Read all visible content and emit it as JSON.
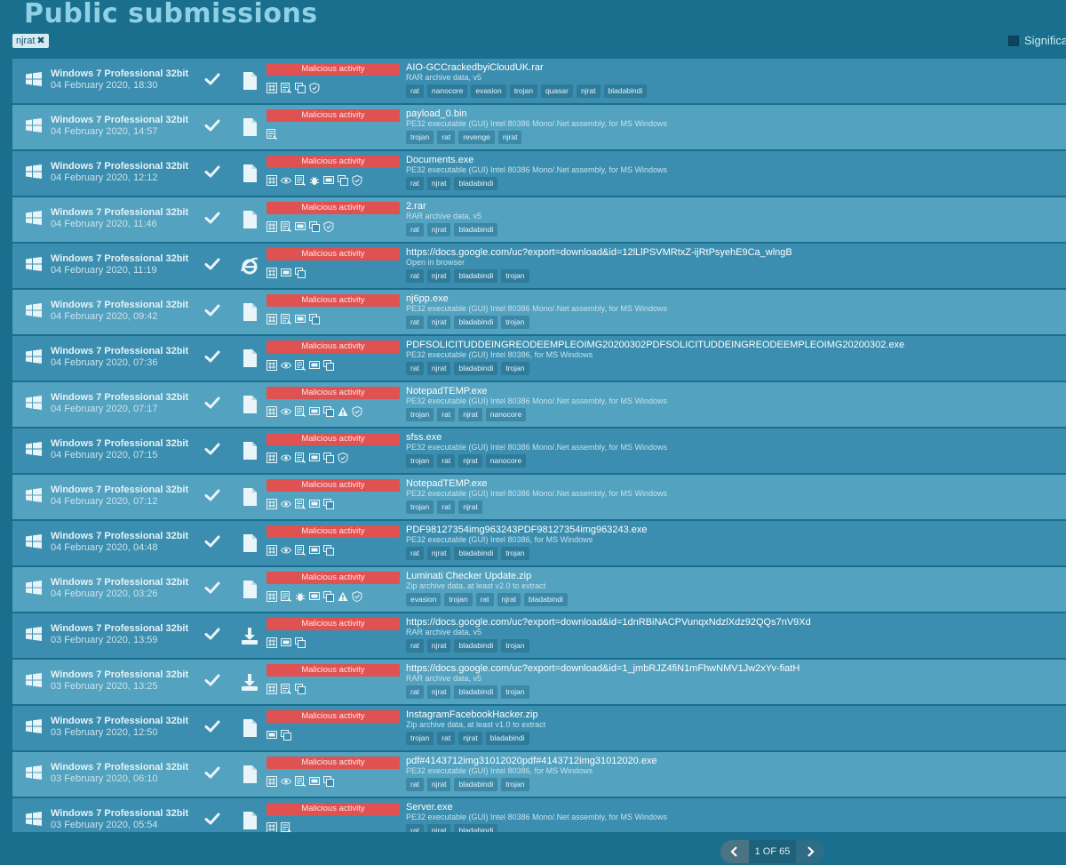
{
  "page": {
    "title": "Public submissions"
  },
  "filter": {
    "tag_label": "njrat",
    "remove_symbol": "✖"
  },
  "significant": {
    "label": "Significa"
  },
  "verdict_label": "Malicious activity",
  "pager": {
    "label": "1 OF 65"
  },
  "rows": [
    {
      "os": "Windows 7 Professional 32bit",
      "date": "04 February 2020, 18:30",
      "icon": "file",
      "badges": [
        "net",
        "exe",
        "win",
        "shield"
      ],
      "name": "AIO-GCCrackedbyiCloudUK.rar",
      "ftype": "RAR archive data, v5",
      "tags": [
        "rat",
        "nanocore",
        "evasion",
        "trojan",
        "quasar",
        "njrat",
        "bladabindi"
      ]
    },
    {
      "os": "Windows 7 Professional 32bit",
      "date": "04 February 2020, 14:57",
      "icon": "file",
      "badges": [
        "exe"
      ],
      "name": "payload_0.bin",
      "ftype": "PE32 executable (GUI) Intel 80386 Mono/.Net assembly, for MS Windows",
      "tags": [
        "trojan",
        "rat",
        "revenge",
        "njrat"
      ]
    },
    {
      "os": "Windows 7 Professional 32bit",
      "date": "04 February 2020, 12:12",
      "icon": "file",
      "badges": [
        "net",
        "eye",
        "exe",
        "bug",
        "dll",
        "win",
        "shield"
      ],
      "name": "Documents.exe",
      "ftype": "PE32 executable (GUI) Intel 80386 Mono/.Net assembly, for MS Windows",
      "tags": [
        "rat",
        "njrat",
        "bladabindi"
      ]
    },
    {
      "os": "Windows 7 Professional 32bit",
      "date": "04 February 2020, 11:46",
      "icon": "file",
      "badges": [
        "net",
        "exe",
        "dll",
        "win",
        "shield"
      ],
      "name": "2.rar",
      "ftype": "RAR archive data, v5",
      "tags": [
        "rat",
        "njrat",
        "bladabindi"
      ]
    },
    {
      "os": "Windows 7 Professional 32bit",
      "date": "04 February 2020, 11:19",
      "icon": "ie",
      "badges": [
        "net",
        "dll",
        "win"
      ],
      "name": "https://docs.google.com/uc?export=download&id=12lLlPSVMRtxZ-ijRtPsyehE9Ca_wlngB",
      "ftype": "Open in browser",
      "tags": [
        "rat",
        "njrat",
        "bladabindi",
        "trojan"
      ]
    },
    {
      "os": "Windows 7 Professional 32bit",
      "date": "04 February 2020, 09:42",
      "icon": "file",
      "badges": [
        "net",
        "exe",
        "dll",
        "win"
      ],
      "name": "nj6pp.exe",
      "ftype": "PE32 executable (GUI) Intel 80386 Mono/.Net assembly, for MS Windows",
      "tags": [
        "rat",
        "njrat",
        "bladabindi",
        "trojan"
      ]
    },
    {
      "os": "Windows 7 Professional 32bit",
      "date": "04 February 2020, 07:36",
      "icon": "file",
      "badges": [
        "net",
        "eye",
        "exe",
        "dll",
        "win"
      ],
      "name": "PDFSOLICITUDDEINGREODEEMPLEOIMG20200302PDFSOLICITUDDEINGREODEEMPLEOIMG20200302.exe",
      "ftype": "PE32 executable (GUI) Intel 80386, for MS Windows",
      "tags": [
        "rat",
        "njrat",
        "bladabindi",
        "trojan"
      ]
    },
    {
      "os": "Windows 7 Professional 32bit",
      "date": "04 February 2020, 07:17",
      "icon": "file",
      "badges": [
        "net",
        "eye",
        "exe",
        "dll",
        "win",
        "warn",
        "shield"
      ],
      "name": "NotepadTEMP.exe",
      "ftype": "PE32 executable (GUI) Intel 80386 Mono/.Net assembly, for MS Windows",
      "tags": [
        "trojan",
        "rat",
        "njrat",
        "nanocore"
      ]
    },
    {
      "os": "Windows 7 Professional 32bit",
      "date": "04 February 2020, 07:15",
      "icon": "file",
      "badges": [
        "net",
        "eye",
        "exe",
        "dll",
        "win",
        "shield"
      ],
      "name": "sfss.exe",
      "ftype": "PE32 executable (GUI) Intel 80386 Mono/.Net assembly, for MS Windows",
      "tags": [
        "trojan",
        "rat",
        "njrat",
        "nanocore"
      ]
    },
    {
      "os": "Windows 7 Professional 32bit",
      "date": "04 February 2020, 07:12",
      "icon": "file",
      "badges": [
        "net",
        "eye",
        "exe",
        "dll",
        "win"
      ],
      "name": "NotepadTEMP.exe",
      "ftype": "PE32 executable (GUI) Intel 80386 Mono/.Net assembly, for MS Windows",
      "tags": [
        "trojan",
        "rat",
        "njrat"
      ]
    },
    {
      "os": "Windows 7 Professional 32bit",
      "date": "04 February 2020, 04:48",
      "icon": "file",
      "badges": [
        "net",
        "eye",
        "exe",
        "dll",
        "win"
      ],
      "name": "PDF98127354img963243PDF98127354img963243.exe",
      "ftype": "PE32 executable (GUI) Intel 80386, for MS Windows",
      "tags": [
        "rat",
        "njrat",
        "bladabindi",
        "trojan"
      ]
    },
    {
      "os": "Windows 7 Professional 32bit",
      "date": "04 February 2020, 03:26",
      "icon": "file",
      "badges": [
        "net",
        "exe",
        "bug",
        "dll",
        "win",
        "warn",
        "shield"
      ],
      "name": "Luminati Checker Update.zip",
      "ftype": "Zip archive data, at least v2.0 to extract",
      "tags": [
        "evasion",
        "trojan",
        "rat",
        "njrat",
        "bladabindi"
      ]
    },
    {
      "os": "Windows 7 Professional 32bit",
      "date": "03 February 2020, 13:59",
      "icon": "download",
      "badges": [
        "net",
        "dll",
        "win"
      ],
      "name": "https://docs.google.com/uc?export=download&id=1dnRBiNACPVunqxNdzlXdz92QQs7nV9Xd",
      "ftype": "RAR archive data, v5",
      "tags": [
        "rat",
        "njrat",
        "bladabindi",
        "trojan"
      ]
    },
    {
      "os": "Windows 7 Professional 32bit",
      "date": "03 February 2020, 13:25",
      "icon": "download",
      "badges": [
        "net",
        "exe",
        "win"
      ],
      "name": "https://docs.google.com/uc?export=download&id=1_jmbRJZ4fiN1mFhwNMV1Jw2xYv-fiatH",
      "ftype": "RAR archive data, v5",
      "tags": [
        "rat",
        "njrat",
        "bladabindi",
        "trojan"
      ]
    },
    {
      "os": "Windows 7 Professional 32bit",
      "date": "03 February 2020, 12:50",
      "icon": "file",
      "badges": [
        "dll",
        "win"
      ],
      "name": "InstagramFacebookHacker.zip",
      "ftype": "Zip archive data, at least v1.0 to extract",
      "tags": [
        "trojan",
        "rat",
        "njrat",
        "bladabindi"
      ]
    },
    {
      "os": "Windows 7 Professional 32bit",
      "date": "03 February 2020, 06:10",
      "icon": "file",
      "badges": [
        "net",
        "eye",
        "exe",
        "dll",
        "win"
      ],
      "name": "pdf#4143712img31012020pdf#4143712img31012020.exe",
      "ftype": "PE32 executable (GUI) Intel 80386, for MS Windows",
      "tags": [
        "rat",
        "njrat",
        "bladabindi",
        "trojan"
      ]
    },
    {
      "os": "Windows 7 Professional 32bit",
      "date": "03 February 2020, 05:54",
      "icon": "file",
      "badges": [
        "net",
        "exe"
      ],
      "name": "Server.exe",
      "ftype": "PE32 executable (GUI) Intel 80386 Mono/.Net assembly, for MS Windows",
      "tags": [
        "rat",
        "njrat",
        "bladabindi"
      ]
    }
  ]
}
